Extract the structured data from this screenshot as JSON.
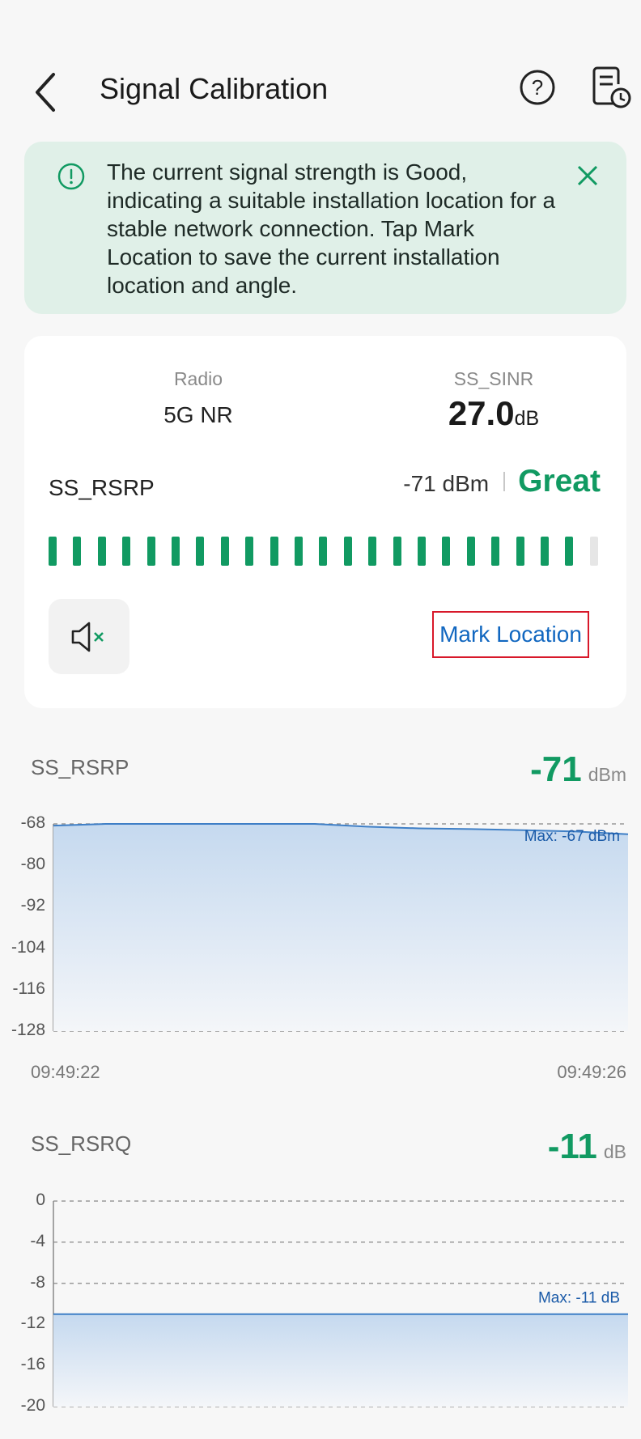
{
  "header": {
    "title": "Signal Calibration",
    "icons": [
      "back-arrow-icon",
      "help-icon",
      "history-report-icon"
    ]
  },
  "banner": {
    "text": "The current signal strength is Good, indicating a suitable installation location for a stable network connection. Tap Mark Location to save the current installation location and angle.",
    "background": "#e0f0e8",
    "accent": "#119a62"
  },
  "card": {
    "radio_label": "Radio",
    "radio_value": "5G NR",
    "sinr_label": "SS_SINR",
    "sinr_value": "27.0",
    "sinr_unit": "dB",
    "rsrp_label": "SS_RSRP",
    "rsrp_value": "-71 dBm",
    "rsrp_quality": "Great",
    "signal_bars_total": 23,
    "signal_bars_filled": 22,
    "mark_location_label": "Mark Location",
    "mute_icon": "speaker-muted-icon"
  },
  "colors": {
    "green": "#119a62",
    "link_blue": "#1167c0",
    "highlight_red": "#d8182a",
    "chart_line": "#3f7fc6"
  },
  "chart_data": [
    {
      "type": "area",
      "title": "SS_RSRP",
      "current_value": "-71",
      "current_unit": "dBm",
      "y_ticks": [
        "-68",
        "-80",
        "-92",
        "-104",
        "-116",
        "-128"
      ],
      "ylim": [
        -128,
        -68
      ],
      "x_labels": [
        "09:49:22",
        "09:49:26"
      ],
      "series": [
        {
          "values": [
            -68.5,
            -68,
            -68,
            -68,
            -68,
            -68,
            -68.8,
            -69.3,
            -69.5,
            -69.8,
            -70.2,
            -71
          ]
        }
      ],
      "max_label": "Max: -67 dBm"
    },
    {
      "type": "area",
      "title": "SS_RSRQ",
      "current_value": "-11",
      "current_unit": "dB",
      "y_ticks": [
        "0",
        "-4",
        "-8",
        "-12",
        "-16",
        "-20"
      ],
      "ylim": [
        -20,
        0
      ],
      "x_labels": [],
      "series": [
        {
          "values": [
            -11,
            -11,
            -11,
            -11,
            -11,
            -11,
            -11,
            -11,
            -11,
            -11,
            -11,
            -11
          ]
        }
      ],
      "max_label": "Max: -11 dB"
    }
  ]
}
